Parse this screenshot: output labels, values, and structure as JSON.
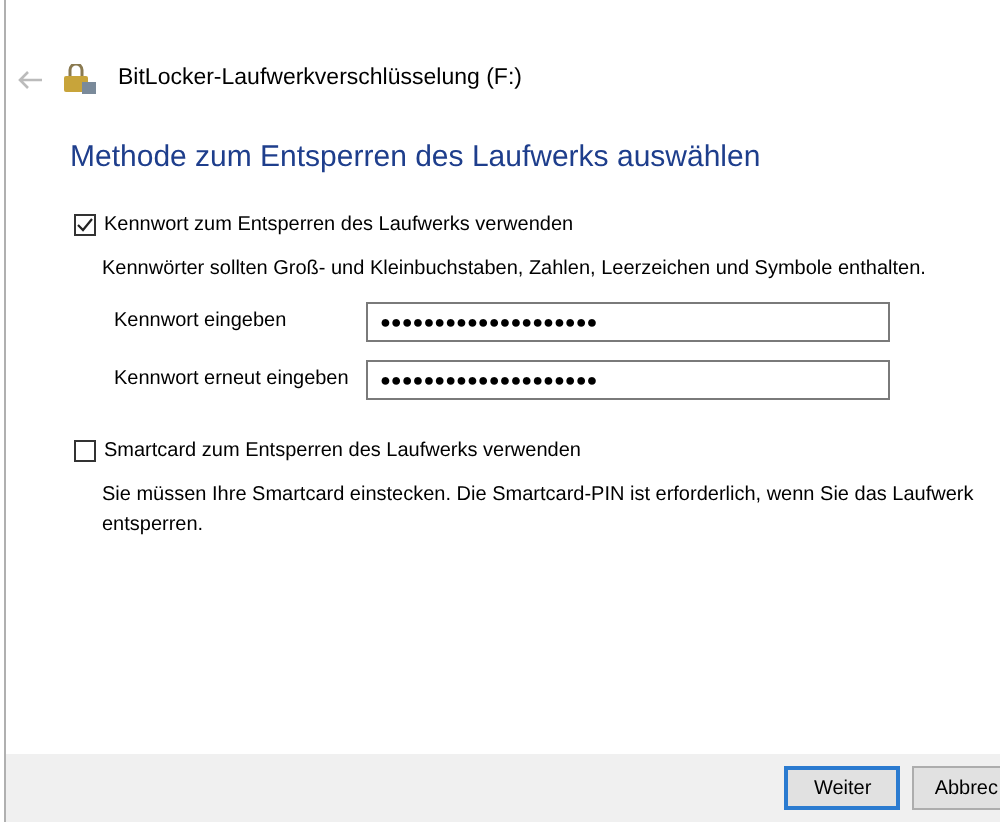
{
  "window": {
    "title": "BitLocker-Laufwerkverschlüsselung (F:)"
  },
  "heading": "Methode zum Entsperren des Laufwerks auswählen",
  "options": [
    {
      "label": "Kennwort zum Entsperren des Laufwerks verwenden",
      "checked": true,
      "hint": "Kennwörter sollten Groß- und Kleinbuchstaben, Zahlen, Leerzeichen und Symbole enthalten.",
      "fields": [
        {
          "label": "Kennwort eingeben",
          "value": "●●●●●●●●●●●●●●●●●●●●"
        },
        {
          "label": "Kennwort erneut eingeben",
          "value": "●●●●●●●●●●●●●●●●●●●●"
        }
      ]
    },
    {
      "label": "Smartcard zum Entsperren des Laufwerks verwenden",
      "checked": false,
      "hint": "Sie müssen Ihre Smartcard einstecken. Die Smartcard-PIN ist erforderlich, wenn Sie das Laufwerk entsperren."
    }
  ],
  "buttons": [
    {
      "label": "Weiter",
      "selected": true
    },
    {
      "label": "Abbrec",
      "selected": false
    }
  ]
}
